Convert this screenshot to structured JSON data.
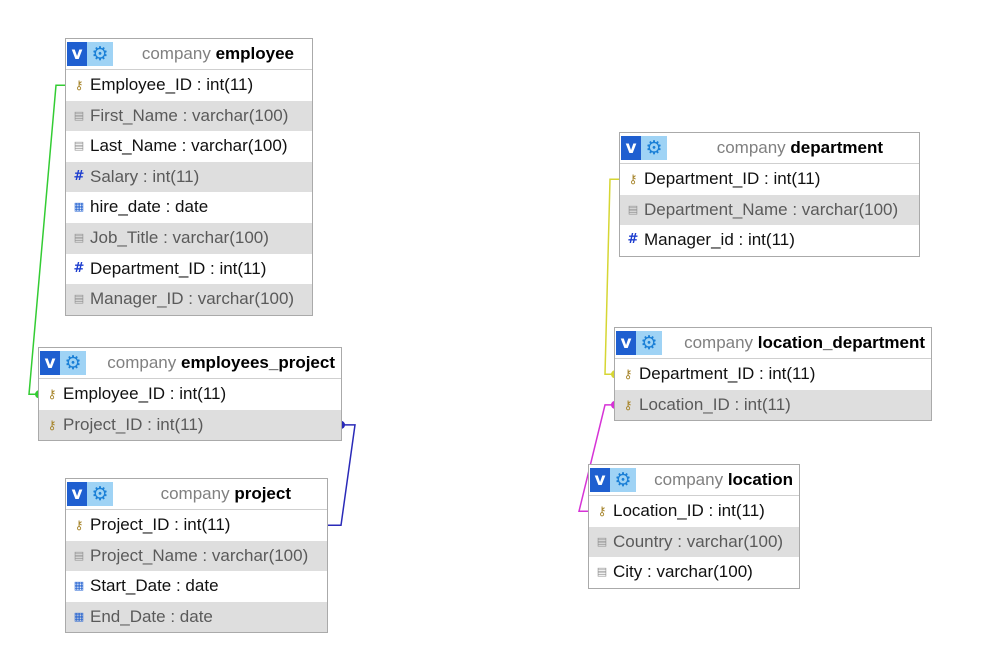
{
  "tables": {
    "employee": {
      "schema": "company",
      "name": "employee",
      "columns": [
        {
          "label": "Employee_ID : int(11)",
          "icon": "key-icon"
        },
        {
          "label": "First_Name : varchar(100)",
          "icon": "text-field-icon"
        },
        {
          "label": "Last_Name : varchar(100)",
          "icon": "text-field-icon"
        },
        {
          "label": "Salary : int(11)",
          "icon": "number-field-icon"
        },
        {
          "label": "hire_date : date",
          "icon": "date-field-icon"
        },
        {
          "label": "Job_Title : varchar(100)",
          "icon": "text-field-icon"
        },
        {
          "label": "Department_ID : int(11)",
          "icon": "number-field-icon"
        },
        {
          "label": "Manager_ID : varchar(100)",
          "icon": "text-field-icon"
        }
      ]
    },
    "employees_project": {
      "schema": "company",
      "name": "employees_project",
      "columns": [
        {
          "label": "Employee_ID : int(11)",
          "icon": "key-icon"
        },
        {
          "label": "Project_ID : int(11)",
          "icon": "key-icon"
        }
      ]
    },
    "project": {
      "schema": "company",
      "name": "project",
      "columns": [
        {
          "label": "Project_ID : int(11)",
          "icon": "key-icon"
        },
        {
          "label": "Project_Name : varchar(100)",
          "icon": "text-field-icon"
        },
        {
          "label": "Start_Date : date",
          "icon": "date-field-icon"
        },
        {
          "label": "End_Date : date",
          "icon": "date-field-icon"
        }
      ]
    },
    "department": {
      "schema": "company",
      "name": "department",
      "columns": [
        {
          "label": "Department_ID : int(11)",
          "icon": "key-icon"
        },
        {
          "label": "Department_Name : varchar(100)",
          "icon": "text-field-icon"
        },
        {
          "label": "Manager_id : int(11)",
          "icon": "number-field-icon"
        }
      ]
    },
    "location_department": {
      "schema": "company",
      "name": "location_department",
      "columns": [
        {
          "label": "Department_ID : int(11)",
          "icon": "key-icon"
        },
        {
          "label": "Location_ID : int(11)",
          "icon": "key-icon"
        }
      ]
    },
    "location": {
      "schema": "company",
      "name": "location",
      "columns": [
        {
          "label": "Location_ID : int(11)",
          "icon": "key-icon"
        },
        {
          "label": "Country : varchar(100)",
          "icon": "text-field-icon"
        },
        {
          "label": "City : varchar(100)",
          "icon": "text-field-icon"
        }
      ]
    }
  },
  "relations": [
    {
      "from": "employees_project.Employee_ID",
      "to": "employee.Employee_ID",
      "color": "#33cc33"
    },
    {
      "from": "employees_project.Project_ID",
      "to": "project.Project_ID",
      "color": "#2a2ab8"
    },
    {
      "from": "location_department.Department_ID",
      "to": "department.Department_ID",
      "color": "#d6d633"
    },
    {
      "from": "location_department.Location_ID",
      "to": "location.Location_ID",
      "color": "#d633d6"
    }
  ],
  "colors": {
    "header_v": "#1f5fd0",
    "header_gear": "#9fd3f5",
    "row_alt": "#dedede",
    "border": "#aaaaaa"
  }
}
